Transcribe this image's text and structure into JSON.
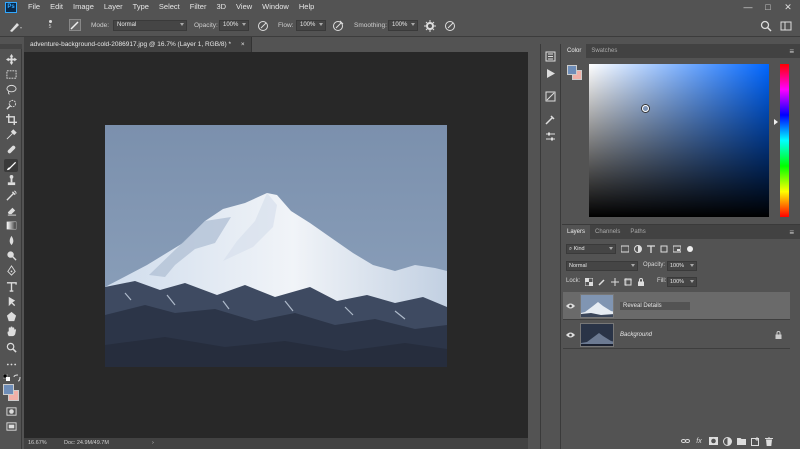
{
  "app": {
    "logo": "Ps"
  },
  "menu": [
    "File",
    "Edit",
    "Image",
    "Layer",
    "Type",
    "Select",
    "Filter",
    "3D",
    "View",
    "Window",
    "Help"
  ],
  "window_controls": {
    "minimize": "—",
    "maximize": "□",
    "close": "✕"
  },
  "options": {
    "brush_size": "5",
    "mode_label": "Mode:",
    "mode_value": "Normal",
    "opacity_label": "Opacity:",
    "opacity_value": "100%",
    "flow_label": "Flow:",
    "flow_value": "100%",
    "smoothing_label": "Smoothing:",
    "smoothing_value": "100%"
  },
  "document": {
    "tab_title": "adventure-background-cold-2086917.jpg @ 16.7% (Layer 1, RGB/8) *",
    "tab_close": "×"
  },
  "status": {
    "zoom": "16.67%",
    "doc": "Doc: 24.9M/49.7M",
    "arrow": "›"
  },
  "colors": {
    "foreground": "#6e8db8",
    "background": "#f0b0a8",
    "picker_hue": "#0066ff",
    "app_bg": "#535353",
    "canvas_bg": "#282828"
  },
  "color_panel": {
    "tabs": [
      "Color",
      "Swatches"
    ]
  },
  "layers_panel": {
    "tabs": [
      "Layers",
      "Channels",
      "Paths"
    ],
    "kind_label": "Kind",
    "blend_mode": "Normal",
    "opacity_label": "Opacity:",
    "opacity_value": "100%",
    "lock_label": "Lock:",
    "fill_label": "Fill:",
    "fill_value": "100%",
    "layers": [
      {
        "name": "Reveal Details",
        "selected": true,
        "locked": false
      },
      {
        "name": "Background",
        "selected": false,
        "locked": true
      }
    ]
  }
}
